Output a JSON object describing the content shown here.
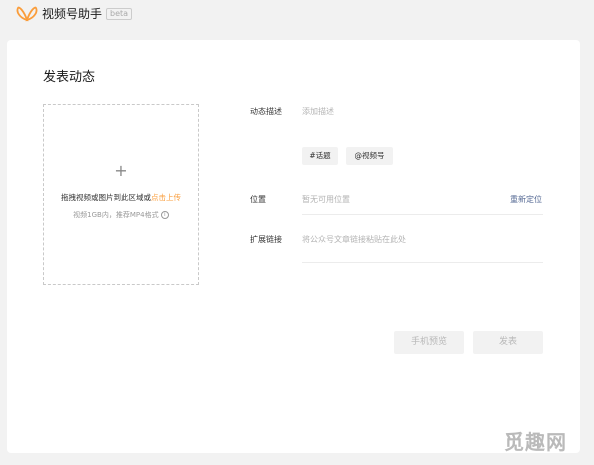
{
  "app": {
    "title": "视频号助手",
    "badge": "beta",
    "logo_color": "#fa9d3b"
  },
  "page": {
    "title": "发表动态"
  },
  "upload": {
    "plus": "+",
    "hint": "拖拽视频或图片到此区域或",
    "link": "点击上传",
    "limit": "视频1GB内，推荐MP4格式",
    "info_icon": "i"
  },
  "form": {
    "description_label": "动态描述",
    "description_placeholder": "添加描述",
    "topic_button": "#话题",
    "mention_button": "@视频号",
    "location_label": "位置",
    "location_value": "暂无可用位置",
    "relocate_link": "重新定位",
    "link_label": "扩展链接",
    "link_placeholder": "将公众号文章链接粘贴在此处"
  },
  "actions": {
    "preview": "手机预览",
    "publish": "发表"
  },
  "watermark": "觅趣网",
  "colors": {
    "accent": "#fa9d3b",
    "link": "#576b95",
    "disabled_text": "#b8b8b8"
  }
}
